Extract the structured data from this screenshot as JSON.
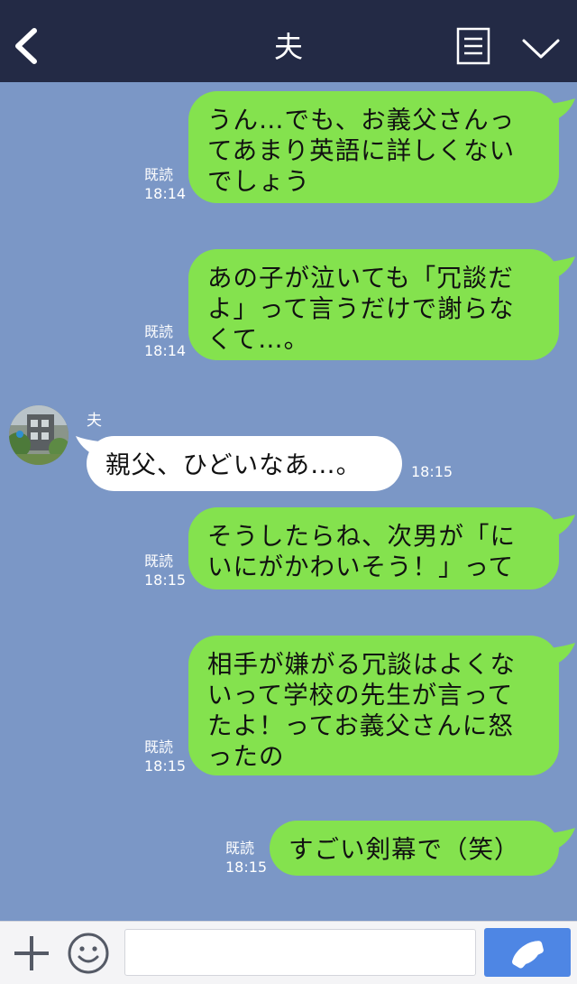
{
  "header": {
    "title": "夫",
    "back_icon": "chevron-left-icon",
    "notes_icon": "notes-icon",
    "menu_icon": "chevron-down-icon"
  },
  "messages": [
    {
      "side": "me",
      "lines": [
        "うん…でも、お義父さんっ",
        "てあまり英語に詳しくない",
        "でしょう"
      ],
      "read": "既読",
      "time": "18:14"
    },
    {
      "side": "me",
      "lines": [
        "あの子が泣いても「冗談だ",
        "よ」って言うだけで謝らな",
        "くて…。"
      ],
      "read": "既読",
      "time": "18:14"
    },
    {
      "side": "other",
      "sender": "夫",
      "lines": [
        "親父、ひどいなあ…。"
      ],
      "time": "18:15"
    },
    {
      "side": "me",
      "lines": [
        "そうしたらね、次男が「に",
        "いにがかわいそう！」って"
      ],
      "read": "既読",
      "time": "18:15"
    },
    {
      "side": "me",
      "lines": [
        "相手が嫌がる冗談はよくな",
        "いって学校の先生が言って",
        "たよ！ってお義父さんに怒",
        "ったの"
      ],
      "read": "既読",
      "time": "18:15"
    },
    {
      "side": "me",
      "lines": [
        "すごい剣幕で（笑）"
      ],
      "read": "既読",
      "time": "18:15"
    }
  ],
  "footer": {
    "plus_icon": "plus-icon",
    "emoji_icon": "emoji-icon",
    "input_placeholder": "",
    "call_icon": "phone-icon"
  },
  "colors": {
    "header_bg": "#232a45",
    "chat_bg": "#7b97c6",
    "my_bubble": "#84e24e",
    "other_bubble": "#ffffff",
    "call_button": "#4e86e4"
  }
}
